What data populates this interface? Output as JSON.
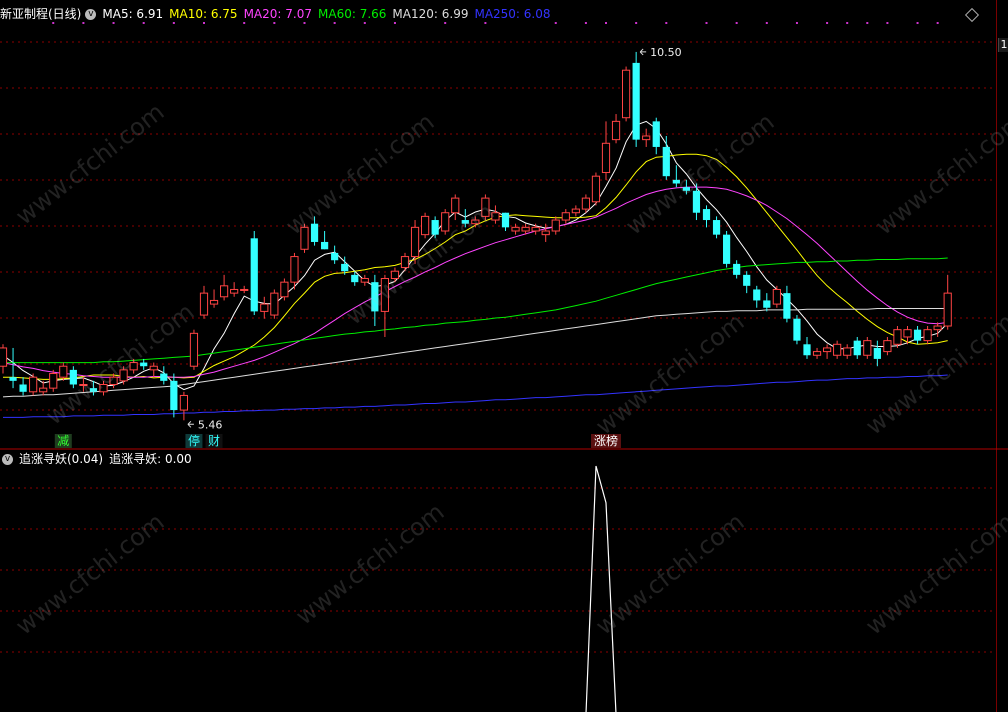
{
  "header": {
    "title": "新亚制程(日线)",
    "ma": [
      {
        "label": "MA5: 6.91",
        "color": "#ffffff"
      },
      {
        "label": "MA10: 6.75",
        "color": "#ffff00"
      },
      {
        "label": "MA20: 7.07",
        "color": "#ff44ff"
      },
      {
        "label": "MA60: 7.66",
        "color": "#00ee00"
      },
      {
        "label": "MA120: 6.99",
        "color": "#dddddd"
      },
      {
        "label": "MA250: 6.08",
        "color": "#3333ff"
      }
    ]
  },
  "subchart": {
    "title": "追涨寻妖(0.04)",
    "value_label": "追涨寻妖: 0.00"
  },
  "axis_box_text": "1",
  "colors": {
    "up": "#ff4444",
    "down": "#33ffff",
    "grid": "#8b0000",
    "separator": "#b00000",
    "indicator": "#ffffff"
  },
  "chart_data": {
    "type": "candlestick",
    "max_label": "10.50",
    "min_label": "5.46",
    "price_range": [
      5.3,
      10.8
    ],
    "candles": [
      [
        6.2,
        6.5,
        6.1,
        6.45
      ],
      [
        6.05,
        6.45,
        5.9,
        6.0
      ],
      [
        5.95,
        6.05,
        5.8,
        5.85
      ],
      [
        5.85,
        6.1,
        5.8,
        6.05
      ],
      [
        5.85,
        6.0,
        5.8,
        5.9
      ],
      [
        5.9,
        6.15,
        5.85,
        6.1
      ],
      [
        6.05,
        6.25,
        6.0,
        6.2
      ],
      [
        6.15,
        6.2,
        5.9,
        5.95
      ],
      [
        5.95,
        6.05,
        5.85,
        5.95
      ],
      [
        5.9,
        6.0,
        5.8,
        5.85
      ],
      [
        5.85,
        6.0,
        5.8,
        5.95
      ],
      [
        5.95,
        6.1,
        5.9,
        6.05
      ],
      [
        6.0,
        6.2,
        5.95,
        6.15
      ],
      [
        6.15,
        6.3,
        6.1,
        6.25
      ],
      [
        6.25,
        6.3,
        6.15,
        6.2
      ],
      [
        6.15,
        6.25,
        6.05,
        6.2
      ],
      [
        6.1,
        6.2,
        5.95,
        6.0
      ],
      [
        6.0,
        6.1,
        5.5,
        5.6
      ],
      [
        5.6,
        5.85,
        5.46,
        5.8
      ],
      [
        6.2,
        6.7,
        6.15,
        6.65
      ],
      [
        6.9,
        7.3,
        6.85,
        7.2
      ],
      [
        7.05,
        7.25,
        7.0,
        7.1
      ],
      [
        7.15,
        7.45,
        7.1,
        7.3
      ],
      [
        7.2,
        7.35,
        7.15,
        7.25
      ],
      [
        7.25,
        7.3,
        7.2,
        7.25
      ],
      [
        7.95,
        8.05,
        6.9,
        6.95
      ],
      [
        6.95,
        7.15,
        6.85,
        7.05
      ],
      [
        6.9,
        7.25,
        6.85,
        7.2
      ],
      [
        7.15,
        7.4,
        7.1,
        7.35
      ],
      [
        7.35,
        7.75,
        7.25,
        7.7
      ],
      [
        7.8,
        8.15,
        7.75,
        8.1
      ],
      [
        8.15,
        8.25,
        7.85,
        7.9
      ],
      [
        7.9,
        8.05,
        7.8,
        7.8
      ],
      [
        7.75,
        7.85,
        7.6,
        7.65
      ],
      [
        7.6,
        7.7,
        7.45,
        7.5
      ],
      [
        7.45,
        7.5,
        7.3,
        7.35
      ],
      [
        7.35,
        7.45,
        7.3,
        7.4
      ],
      [
        7.35,
        7.45,
        6.75,
        6.95
      ],
      [
        6.95,
        7.45,
        6.6,
        7.4
      ],
      [
        7.4,
        7.55,
        7.35,
        7.5
      ],
      [
        7.55,
        7.75,
        7.5,
        7.7
      ],
      [
        7.7,
        8.2,
        7.6,
        8.1
      ],
      [
        8.0,
        8.3,
        7.95,
        8.25
      ],
      [
        8.2,
        8.25,
        7.95,
        8.0
      ],
      [
        8.05,
        8.35,
        8.0,
        8.3
      ],
      [
        8.3,
        8.55,
        8.2,
        8.5
      ],
      [
        8.2,
        8.35,
        8.1,
        8.15
      ],
      [
        8.15,
        8.25,
        8.1,
        8.2
      ],
      [
        8.25,
        8.55,
        8.2,
        8.5
      ],
      [
        8.2,
        8.4,
        8.15,
        8.3
      ],
      [
        8.3,
        8.3,
        8.05,
        8.1
      ],
      [
        8.05,
        8.15,
        8.0,
        8.1
      ],
      [
        8.05,
        8.15,
        8.0,
        8.1
      ],
      [
        8.05,
        8.15,
        8.0,
        8.1
      ],
      [
        8.0,
        8.15,
        7.9,
        8.05
      ],
      [
        8.05,
        8.25,
        8.0,
        8.2
      ],
      [
        8.2,
        8.35,
        8.15,
        8.3
      ],
      [
        8.3,
        8.4,
        8.25,
        8.35
      ],
      [
        8.35,
        8.55,
        8.3,
        8.5
      ],
      [
        8.45,
        8.85,
        8.4,
        8.8
      ],
      [
        8.85,
        9.55,
        8.75,
        9.25
      ],
      [
        9.3,
        9.65,
        9.25,
        9.55
      ],
      [
        9.6,
        10.3,
        9.55,
        10.25
      ],
      [
        10.35,
        10.5,
        9.2,
        9.3
      ],
      [
        9.3,
        9.45,
        9.2,
        9.35
      ],
      [
        9.55,
        9.6,
        9.1,
        9.2
      ],
      [
        9.2,
        9.35,
        8.75,
        8.8
      ],
      [
        8.75,
        8.95,
        8.65,
        8.7
      ],
      [
        8.65,
        8.75,
        8.55,
        8.6
      ],
      [
        8.6,
        8.7,
        8.2,
        8.3
      ],
      [
        8.35,
        8.4,
        8.1,
        8.2
      ],
      [
        8.2,
        8.25,
        7.95,
        8.0
      ],
      [
        8.0,
        8.05,
        7.55,
        7.6
      ],
      [
        7.6,
        7.65,
        7.4,
        7.45
      ],
      [
        7.45,
        7.5,
        7.2,
        7.3
      ],
      [
        7.25,
        7.3,
        7.0,
        7.1
      ],
      [
        7.1,
        7.2,
        6.95,
        7.0
      ],
      [
        7.05,
        7.3,
        7.0,
        7.25
      ],
      [
        7.2,
        7.3,
        6.8,
        6.85
      ],
      [
        6.85,
        6.9,
        6.5,
        6.55
      ],
      [
        6.5,
        6.6,
        6.3,
        6.35
      ],
      [
        6.35,
        6.45,
        6.3,
        6.4
      ],
      [
        6.4,
        6.5,
        6.3,
        6.45
      ],
      [
        6.35,
        6.55,
        6.3,
        6.5
      ],
      [
        6.35,
        6.5,
        6.3,
        6.45
      ],
      [
        6.55,
        6.6,
        6.3,
        6.35
      ],
      [
        6.35,
        6.6,
        6.3,
        6.55
      ],
      [
        6.45,
        6.55,
        6.2,
        6.3
      ],
      [
        6.4,
        6.6,
        6.35,
        6.55
      ],
      [
        6.5,
        6.75,
        6.45,
        6.7
      ],
      [
        6.6,
        6.75,
        6.5,
        6.7
      ],
      [
        6.7,
        6.75,
        6.5,
        6.55
      ],
      [
        6.55,
        6.75,
        6.5,
        6.7
      ],
      [
        6.7,
        6.8,
        6.6,
        6.75
      ],
      [
        6.75,
        7.45,
        6.7,
        7.2
      ]
    ],
    "ma_lines": [
      {
        "name": "MA5",
        "color": "#ffffff",
        "values": [
          6.35,
          6.25,
          6.14,
          6.06,
          5.97,
          6.0,
          6.02,
          6.03,
          6.04,
          5.99,
          5.93,
          5.94,
          5.99,
          6.05,
          6.13,
          6.18,
          6.11,
          5.96,
          5.88,
          5.93,
          6.17,
          6.44,
          6.65,
          6.92,
          7.16,
          7.09,
          7.06,
          7.05,
          7.17,
          7.29,
          7.44,
          7.65,
          7.73,
          7.76,
          7.63,
          7.5,
          7.37,
          7.29,
          7.31,
          7.36,
          7.52,
          7.7,
          7.87,
          8.02,
          8.19,
          8.31,
          8.24,
          8.31,
          8.35,
          8.32,
          8.25,
          8.23,
          8.16,
          8.12,
          8.09,
          8.11,
          8.14,
          8.2,
          8.3,
          8.43,
          8.66,
          8.91,
          9.27,
          9.5,
          9.55,
          9.45,
          9.24,
          8.98,
          8.83,
          8.64,
          8.48,
          8.34,
          8.17,
          7.96,
          7.77,
          7.56,
          7.38,
          7.25,
          7.12,
          6.98,
          6.82,
          6.64,
          6.52,
          6.44,
          6.44,
          6.47,
          6.49,
          6.47,
          6.47,
          6.48,
          6.52,
          6.58,
          6.61,
          6.65,
          6.79
        ]
      },
      {
        "name": "MA10",
        "color": "#ffff00",
        "values": [
          6.05,
          6.05,
          6.04,
          6.03,
          6.02,
          6.02,
          6.03,
          6.04,
          6.06,
          6.08,
          6.08,
          6.08,
          6.06,
          6.05,
          6.06,
          6.04,
          6.05,
          6.05,
          6.04,
          6.05,
          6.13,
          6.21,
          6.27,
          6.33,
          6.41,
          6.49,
          6.6,
          6.73,
          6.89,
          7.06,
          7.2,
          7.35,
          7.43,
          7.47,
          7.48,
          7.5,
          7.52,
          7.55,
          7.56,
          7.58,
          7.62,
          7.66,
          7.73,
          7.81,
          7.9,
          8.0,
          8.05,
          8.13,
          8.19,
          8.24,
          8.26,
          8.27,
          8.26,
          8.25,
          8.24,
          8.23,
          8.23,
          8.23,
          8.24,
          8.26,
          8.37,
          8.51,
          8.68,
          8.86,
          9.0,
          9.06,
          9.07,
          9.09,
          9.1,
          9.1,
          9.08,
          9.03,
          8.92,
          8.79,
          8.64,
          8.47,
          8.3,
          8.13,
          7.96,
          7.79,
          7.61,
          7.44,
          7.3,
          7.18,
          7.07,
          6.95,
          6.84,
          6.74,
          6.66,
          6.6,
          6.53,
          6.5,
          6.51,
          6.52,
          6.55
        ]
      },
      {
        "name": "MA20",
        "color": "#ff44ff",
        "values": [
          6.25,
          6.22,
          6.19,
          6.17,
          6.14,
          6.12,
          6.1,
          6.09,
          6.07,
          6.06,
          6.05,
          6.05,
          6.05,
          6.05,
          6.05,
          6.06,
          6.06,
          6.05,
          6.05,
          6.06,
          6.09,
          6.12,
          6.16,
          6.2,
          6.24,
          6.28,
          6.33,
          6.39,
          6.45,
          6.51,
          6.58,
          6.65,
          6.74,
          6.83,
          6.92,
          7.0,
          7.08,
          7.15,
          7.22,
          7.29,
          7.36,
          7.42,
          7.49,
          7.55,
          7.62,
          7.68,
          7.74,
          7.79,
          7.84,
          7.89,
          7.93,
          7.97,
          8.01,
          8.05,
          8.08,
          8.11,
          8.14,
          8.17,
          8.2,
          8.24,
          8.3,
          8.36,
          8.43,
          8.49,
          8.55,
          8.59,
          8.62,
          8.64,
          8.65,
          8.65,
          8.65,
          8.64,
          8.62,
          8.58,
          8.53,
          8.47,
          8.4,
          8.31,
          8.22,
          8.11,
          8.0,
          7.88,
          7.75,
          7.62,
          7.49,
          7.36,
          7.24,
          7.13,
          7.03,
          6.94,
          6.87,
          6.82,
          6.79,
          6.78,
          6.8
        ]
      },
      {
        "name": "MA60",
        "color": "#00ee00",
        "values": [
          6.25,
          6.25,
          6.25,
          6.25,
          6.25,
          6.25,
          6.25,
          6.25,
          6.25,
          6.25,
          6.26,
          6.26,
          6.27,
          6.28,
          6.29,
          6.3,
          6.31,
          6.32,
          6.33,
          6.34,
          6.36,
          6.38,
          6.4,
          6.42,
          6.44,
          6.46,
          6.48,
          6.5,
          6.52,
          6.54,
          6.56,
          6.58,
          6.6,
          6.62,
          6.64,
          6.65,
          6.67,
          6.68,
          6.7,
          6.71,
          6.73,
          6.74,
          6.76,
          6.77,
          6.79,
          6.8,
          6.81,
          6.83,
          6.84,
          6.86,
          6.87,
          6.89,
          6.91,
          6.93,
          6.95,
          6.97,
          7.0,
          7.03,
          7.06,
          7.09,
          7.13,
          7.17,
          7.21,
          7.25,
          7.29,
          7.33,
          7.36,
          7.39,
          7.42,
          7.45,
          7.48,
          7.51,
          7.53,
          7.55,
          7.57,
          7.58,
          7.59,
          7.6,
          7.61,
          7.62,
          7.62,
          7.63,
          7.63,
          7.64,
          7.64,
          7.65,
          7.65,
          7.66,
          7.66,
          7.66,
          7.67,
          7.67,
          7.67,
          7.67,
          7.68
        ]
      },
      {
        "name": "MA120",
        "color": "#dddddd",
        "values": [
          5.78,
          5.79,
          5.79,
          5.8,
          5.81,
          5.81,
          5.82,
          5.83,
          5.84,
          5.85,
          5.86,
          5.87,
          5.88,
          5.89,
          5.9,
          5.91,
          5.92,
          5.93,
          5.95,
          5.97,
          5.99,
          6.01,
          6.03,
          6.05,
          6.07,
          6.09,
          6.11,
          6.13,
          6.15,
          6.17,
          6.19,
          6.21,
          6.23,
          6.25,
          6.27,
          6.29,
          6.31,
          6.33,
          6.35,
          6.37,
          6.39,
          6.41,
          6.43,
          6.45,
          6.47,
          6.49,
          6.51,
          6.53,
          6.55,
          6.57,
          6.59,
          6.61,
          6.63,
          6.65,
          6.67,
          6.69,
          6.71,
          6.73,
          6.75,
          6.77,
          6.79,
          6.81,
          6.83,
          6.85,
          6.87,
          6.89,
          6.9,
          6.91,
          6.92,
          6.93,
          6.94,
          6.95,
          6.95,
          6.96,
          6.96,
          6.96,
          6.97,
          6.97,
          6.97,
          6.97,
          6.98,
          6.98,
          6.98,
          6.98,
          6.98,
          6.98,
          6.98,
          6.99,
          6.99,
          6.99,
          6.99,
          6.99,
          6.99,
          6.99,
          6.99
        ]
      },
      {
        "name": "MA250",
        "color": "#3333ff",
        "values": [
          5.5,
          5.5,
          5.5,
          5.51,
          5.51,
          5.51,
          5.51,
          5.52,
          5.52,
          5.52,
          5.53,
          5.53,
          5.53,
          5.54,
          5.54,
          5.54,
          5.55,
          5.55,
          5.56,
          5.56,
          5.57,
          5.57,
          5.58,
          5.58,
          5.59,
          5.59,
          5.6,
          5.6,
          5.61,
          5.61,
          5.62,
          5.62,
          5.63,
          5.63,
          5.64,
          5.64,
          5.65,
          5.65,
          5.66,
          5.67,
          5.67,
          5.68,
          5.69,
          5.69,
          5.7,
          5.71,
          5.71,
          5.72,
          5.73,
          5.74,
          5.74,
          5.75,
          5.76,
          5.77,
          5.77,
          5.78,
          5.79,
          5.8,
          5.81,
          5.81,
          5.82,
          5.83,
          5.84,
          5.85,
          5.86,
          5.87,
          5.88,
          5.89,
          5.9,
          5.91,
          5.92,
          5.93,
          5.93,
          5.94,
          5.95,
          5.96,
          5.97,
          5.98,
          5.98,
          5.99,
          6.0,
          6.01,
          6.01,
          6.02,
          6.03,
          6.03,
          6.04,
          6.04,
          6.05,
          6.05,
          6.06,
          6.06,
          6.07,
          6.07,
          6.08
        ]
      }
    ],
    "markers": [
      {
        "index": 6,
        "text": "减",
        "bg": "#1f3d1f",
        "fg": "#33ff33"
      },
      {
        "index": 19,
        "text": "停",
        "bg": "#0f3a3a",
        "fg": "#33ffff"
      },
      {
        "index": 21,
        "text": "财",
        "bg": "#101010",
        "fg": "#33ffff"
      },
      {
        "index": 60,
        "text": "涨榜",
        "bg": "#5a1010",
        "fg": "#ffffff"
      }
    ],
    "signal_dots": [
      5,
      8,
      11,
      14,
      17,
      20,
      24,
      27,
      30,
      33,
      36,
      39,
      44,
      48,
      55,
      58,
      60,
      63,
      66,
      70,
      73,
      76,
      79,
      82,
      84,
      86,
      88,
      91,
      93
    ],
    "indicator": {
      "name": "追涨寻妖",
      "values": [
        0,
        0,
        0,
        0,
        0,
        0,
        0,
        0,
        0,
        0,
        0,
        0,
        0,
        0,
        0,
        0,
        0,
        0,
        0,
        0,
        0,
        0,
        0,
        0,
        0,
        0,
        0,
        0,
        0,
        0,
        0,
        0,
        0,
        0,
        0,
        0,
        0,
        0,
        0,
        0,
        0,
        0,
        0,
        0,
        0,
        0,
        0,
        0,
        0,
        0,
        0,
        0,
        0,
        0,
        0,
        0,
        0,
        0,
        0,
        1,
        0.85,
        0,
        0,
        0,
        0,
        0,
        0,
        0,
        0,
        0,
        0,
        0,
        0,
        0,
        0,
        0,
        0,
        0,
        0,
        0,
        0,
        0,
        0,
        0,
        0,
        0,
        0,
        0,
        0,
        0,
        0,
        0,
        0,
        0,
        0
      ],
      "peak_index": 59
    }
  },
  "watermark": "www.cfchi.com"
}
